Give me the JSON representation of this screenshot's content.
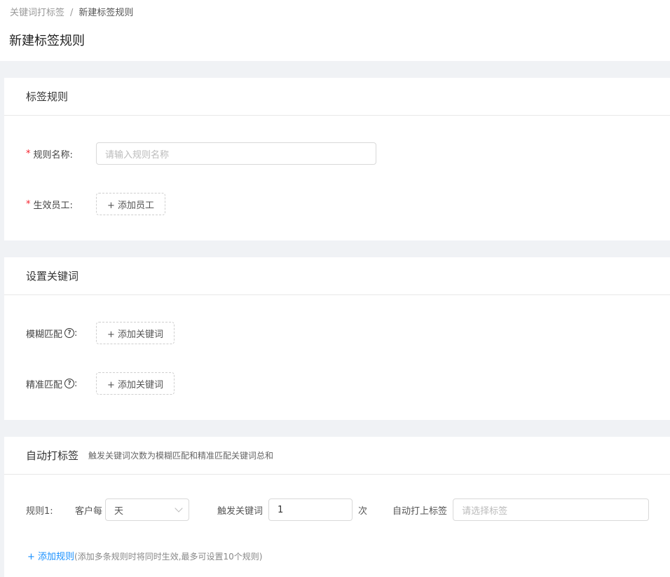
{
  "breadcrumb": {
    "parent": "关键词打标签",
    "separator": "/",
    "current": "新建标签规则"
  },
  "page_title": "新建标签规则",
  "tag_rule_card": {
    "title": "标签规则",
    "rule_name": {
      "label": "规则名称:",
      "placeholder": "请输入规则名称"
    },
    "staff": {
      "label": "生效员工:",
      "button": "+ 添加员工"
    }
  },
  "keyword_card": {
    "title": "设置关键词",
    "fuzzy": {
      "label": "模糊匹配",
      "colon": ":",
      "button": "+ 添加关键词"
    },
    "exact": {
      "label": "精准匹配",
      "colon": ":",
      "button": "+ 添加关键词"
    }
  },
  "auto_tag_card": {
    "title": "自动打标签",
    "subtitle": "触发关键词次数为模糊匹配和精准匹配关键词总和",
    "rule": {
      "label": "规则1:",
      "customer_each": "客户每",
      "period": "天",
      "trigger_label": "触发关键词",
      "count": "1",
      "times": "次",
      "auto_tag_label": "自动打上标签",
      "tag_placeholder": "请选择标签"
    },
    "add_rule": {
      "link": "+ 添加规则",
      "hint": "(添加多条规则时将同时生效,最多可设置10个规则)"
    }
  },
  "colors": {
    "required": "#f5222d",
    "link": "#1890ff",
    "background": "#f0f2f5"
  }
}
